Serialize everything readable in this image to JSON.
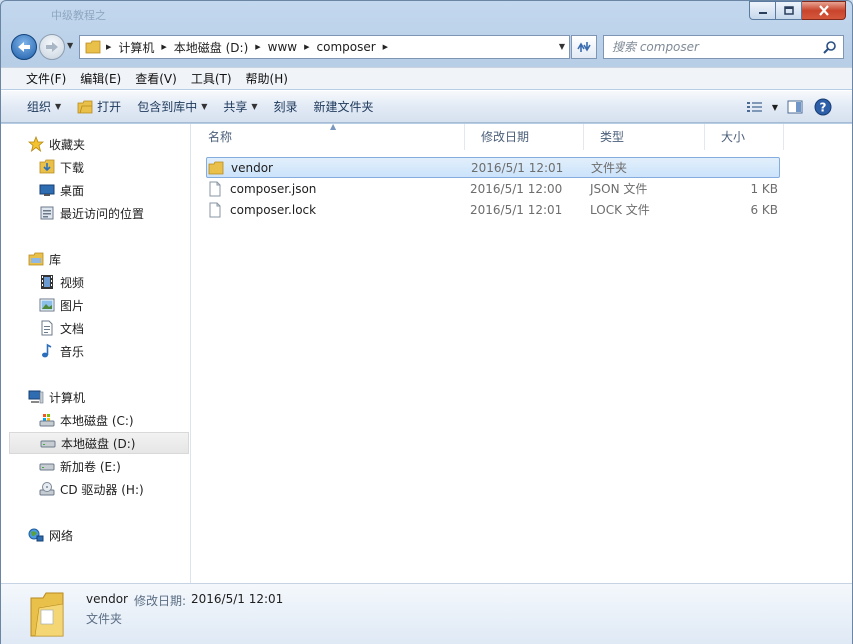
{
  "window": {
    "faded_title": "中级教程之",
    "controls": {
      "minimize": "–",
      "maximize": "□",
      "close": "✕"
    }
  },
  "nav": {
    "breadcrumbs": [
      "计算机",
      "本地磁盘 (D:)",
      "www",
      "composer"
    ],
    "search_placeholder": "搜索 composer"
  },
  "menu": [
    "文件(F)",
    "编辑(E)",
    "查看(V)",
    "工具(T)",
    "帮助(H)"
  ],
  "toolbar": {
    "organize": "组织",
    "open": "打开",
    "include_in_library": "包含到库中",
    "share": "共享",
    "burn": "刻录",
    "new_folder": "新建文件夹"
  },
  "sidebar": {
    "favorites": {
      "label": "收藏夹",
      "items": [
        "下载",
        "桌面",
        "最近访问的位置"
      ]
    },
    "libraries": {
      "label": "库",
      "items": [
        "视频",
        "图片",
        "文档",
        "音乐"
      ]
    },
    "computer": {
      "label": "计算机",
      "items": [
        "本地磁盘 (C:)",
        "本地磁盘 (D:)",
        "新加卷 (E:)",
        "CD 驱动器 (H:)"
      ]
    },
    "network": {
      "label": "网络"
    }
  },
  "columns": [
    "名称",
    "修改日期",
    "类型",
    "大小"
  ],
  "files": [
    {
      "name": "vendor",
      "date": "2016/5/1 12:01",
      "type": "文件夹",
      "size": ""
    },
    {
      "name": "composer.json",
      "date": "2016/5/1 12:00",
      "type": "JSON 文件",
      "size": "1 KB"
    },
    {
      "name": "composer.lock",
      "date": "2016/5/1 12:01",
      "type": "LOCK 文件",
      "size": "6 KB"
    }
  ],
  "details": {
    "name": "vendor",
    "date_label": "修改日期:",
    "date": "2016/5/1 12:01",
    "type": "文件夹"
  },
  "colors": {
    "selection": "#cbe3fb",
    "selection_border": "#84acdd",
    "folder": "#e8c04a",
    "accent": "#1e395b"
  }
}
